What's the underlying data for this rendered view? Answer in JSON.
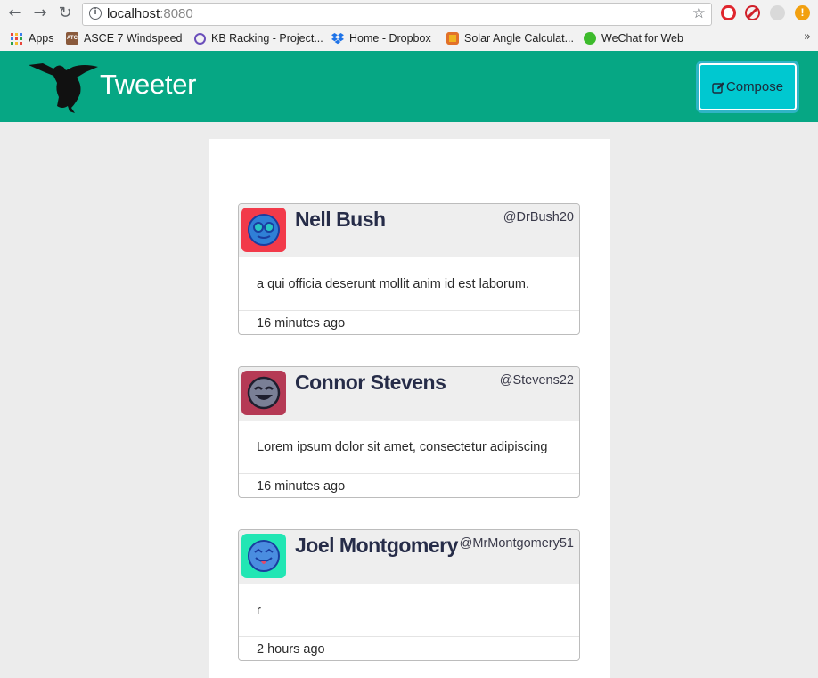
{
  "browser": {
    "back_icon": "back-arrow-icon",
    "forward_icon": "forward-arrow-icon",
    "reload_icon": "reload-icon",
    "url_host": "localhost",
    "url_port": ":8080",
    "bookmarks": [
      {
        "label": "Apps",
        "icon": "apps-grid-icon"
      },
      {
        "label": "ASCE 7 Windspeed",
        "icon": "atc-icon"
      },
      {
        "label": "KB Racking - Project...",
        "icon": "kb-racking-icon"
      },
      {
        "label": "Home - Dropbox",
        "icon": "dropbox-icon"
      },
      {
        "label": "Solar Angle Calculat...",
        "icon": "solar-icon"
      },
      {
        "label": "WeChat for Web",
        "icon": "wechat-icon"
      }
    ],
    "more_bookmarks": "»"
  },
  "header": {
    "brand": "Tweeter",
    "compose_label": "Compose",
    "accent": "#06a784",
    "compose_color": "#00c8d0"
  },
  "tweets": [
    {
      "name": "Nell Bush",
      "handle": "@DrBush20",
      "text": "a qui officia deserunt mollit anim id est laborum.",
      "time": "16 minutes ago",
      "avatar_bg": "#f23a4a",
      "avatar_face": "#2f7fd6"
    },
    {
      "name": "Connor Stevens",
      "handle": "@Stevens22",
      "text": "Lorem ipsum dolor sit amet, consectetur adipiscing",
      "time": "16 minutes ago",
      "avatar_bg": "#b53a55",
      "avatar_face": "#7a7f96"
    },
    {
      "name": "Joel Montgomery",
      "handle": "@MrMontgomery51",
      "text": "r",
      "time": "2 hours ago",
      "avatar_bg": "#22e6b4",
      "avatar_face": "#4a8de0"
    }
  ]
}
